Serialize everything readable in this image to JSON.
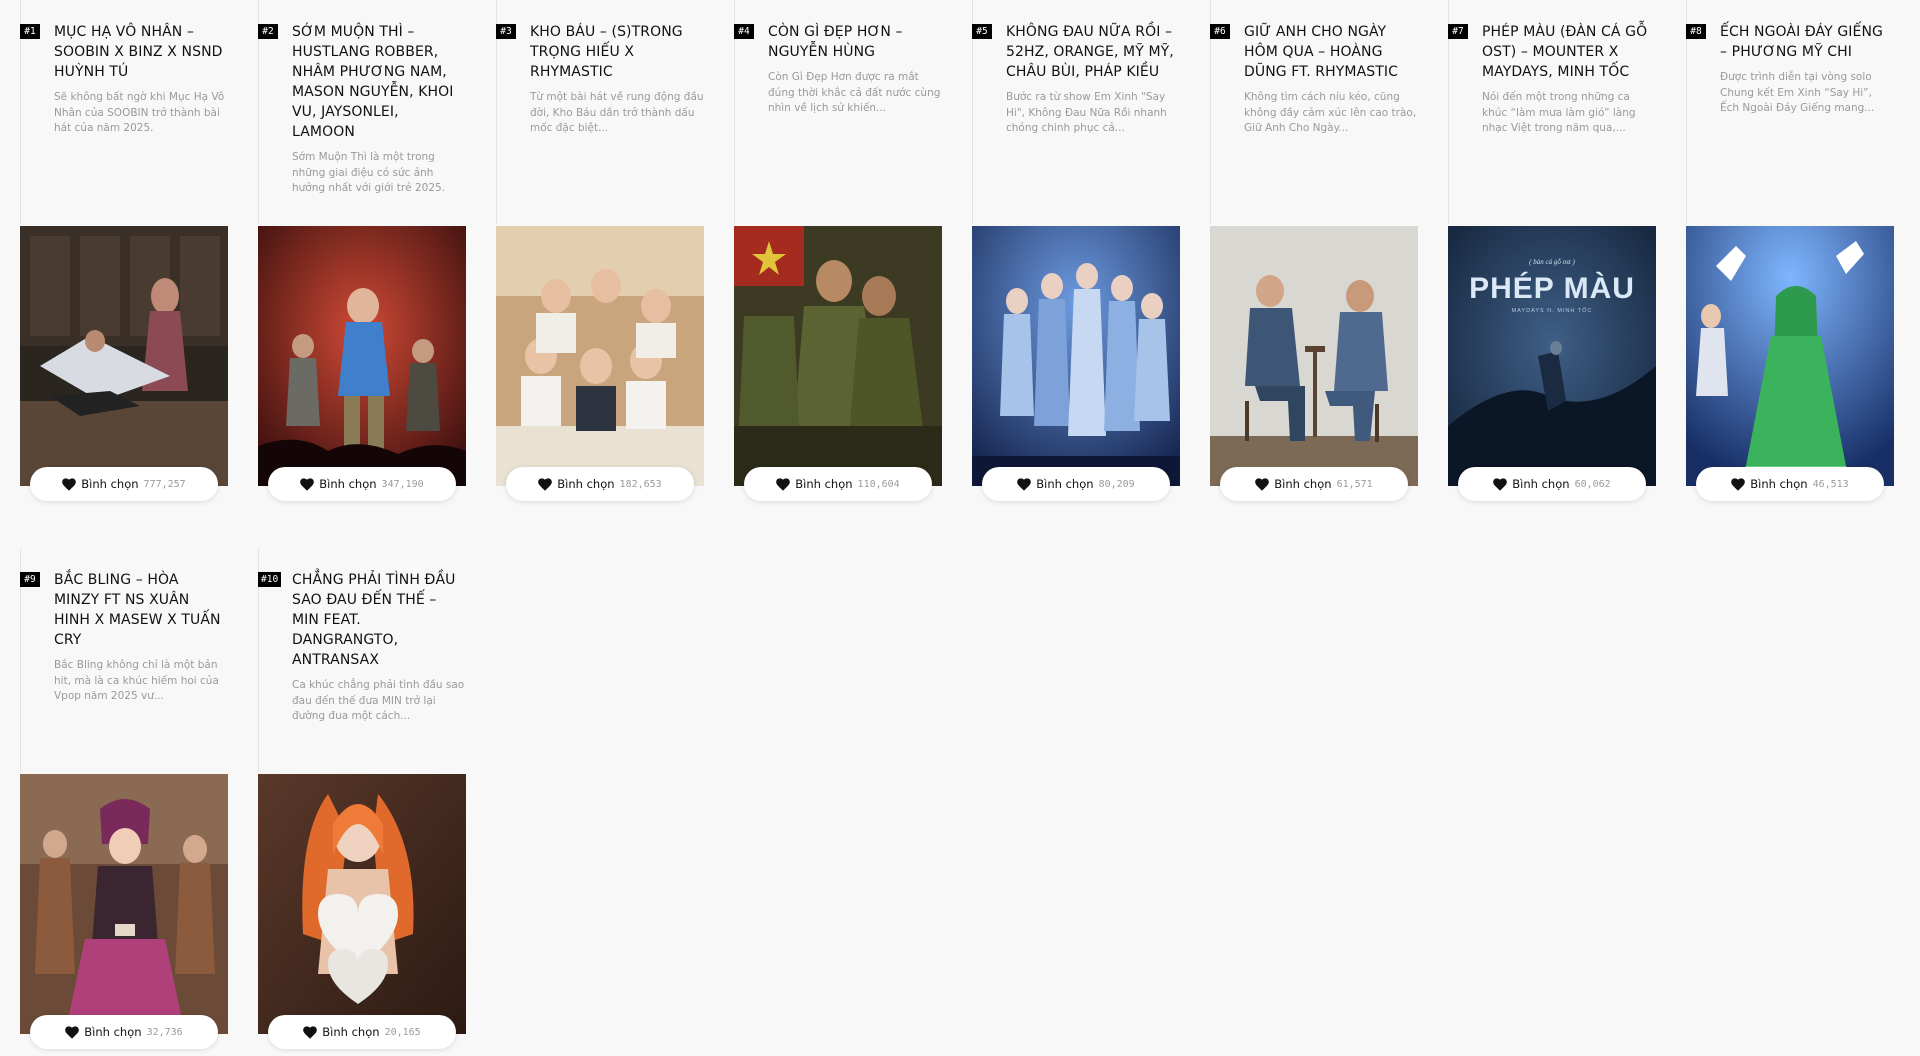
{
  "vote_label": "Bình chọn",
  "cards": [
    {
      "rank": "#1",
      "title": "MỤC HẠ VÔ NHÂN – SOOBIN X BINZ X NSND HUỲNH TÚ",
      "description": "Sẽ không bất ngờ khi Mục Hạ Vô Nhân của SOOBIN trở thành bài hát của năm 2025.",
      "votes": "777,257",
      "image": "stage-performance-image"
    },
    {
      "rank": "#2",
      "title": "SỚM MUỘN THÌ – HUSTLANG ROBBER, NHÂM PHƯƠNG NAM, MASON NGUYỄN, KHOI VU, JAYSONLEI, LAMOON",
      "description": "Sớm Muộn Thì là một trong những giai điệu có sức ảnh hưởng nhất với giới trẻ 2025.",
      "votes": "347,190",
      "image": "concert-stage-image"
    },
    {
      "rank": "#3",
      "title": "KHO BÁU – (S)TRONG TRỌNG HIẾU X RHYMASTIC",
      "description": "Từ một bài hát về rung động đầu đời, Kho Báu dần trở thành dấu mốc đặc biệt...",
      "votes": "182,653",
      "image": "classroom-group-image"
    },
    {
      "rank": "#4",
      "title": "CÒN GÌ ĐẸP HƠN – NGUYỄN HÙNG",
      "description": "Còn Gì Đẹp Hơn được ra mắt đúng thời khắc cả đất nước cùng nhìn về lịch sử khiến...",
      "votes": "110,604",
      "image": "soldiers-image"
    },
    {
      "rank": "#5",
      "title": "KHÔNG ĐAU NỮA RỒI – 52HZ, ORANGE, MỸ MỸ, CHÂU BÙI, PHÁP KIỀU",
      "description": "Bước ra từ show Em Xinh \"Say Hi\", Không Đau Nữa Rồi nhanh chóng chinh phục cả...",
      "votes": "80,209",
      "image": "girl-group-image"
    },
    {
      "rank": "#6",
      "title": "GIỮ ANH CHO NGÀY HÔM QUA – HOÀNG DŨNG FT. RHYMASTIC",
      "description": "Không tìm cách níu kéo, cũng không đầy cảm xúc lên cao trào, Giữ Anh Cho Ngày...",
      "votes": "61,571",
      "image": "two-men-seated-image"
    },
    {
      "rank": "#7",
      "title": "PHÉP MÀU (ĐÀN CÁ GỖ OST) – MOUNTER X MAYDAYS, MINH TỐC",
      "description": "Nói đến một trong những ca khúc “làm mưa làm gió” làng nhạc Việt trong năm qua,...",
      "votes": "60,062",
      "image": "phep-mau-poster-image",
      "poster_caption": "PHÉP MÀU",
      "poster_small_top": "( bàn cá gỗ ost )",
      "poster_small_bottom": "MAYDAYS ft. MINH TỐC"
    },
    {
      "rank": "#8",
      "title": "ẾCH NGOÀI ĐÁY GIẾNG – PHƯƠNG MỸ CHI",
      "description": "Được trình diễn tại vòng solo Chung kết Em Xinh “Say Hi”, Ếch Ngoài Đáy Giếng mang...",
      "votes": "46,513",
      "image": "green-costume-performer-image"
    },
    {
      "rank": "#9",
      "title": "BẮC BLING – HÒA MINZY FT NS XUÂN HINH X MASEW X TUẤN CRY",
      "description": "Bắc Bling không chỉ là một bản hit, mà là ca khúc hiếm hoi của Vpop năm 2025 vư...",
      "votes": "32,736",
      "image": "traditional-dress-image"
    },
    {
      "rank": "#10",
      "title": "CHẲNG PHẢI TÌNH ĐẦU SAO ĐAU ĐẾN THẾ – MIN FEAT. DANGRANGTO, ANTRANSAX",
      "description": "Ca khúc chẳng phải tình đầu sao đau đến thế đưa MIN trở lại đường đua một cách...",
      "votes": "20,165",
      "image": "heart-pillows-image"
    }
  ]
}
